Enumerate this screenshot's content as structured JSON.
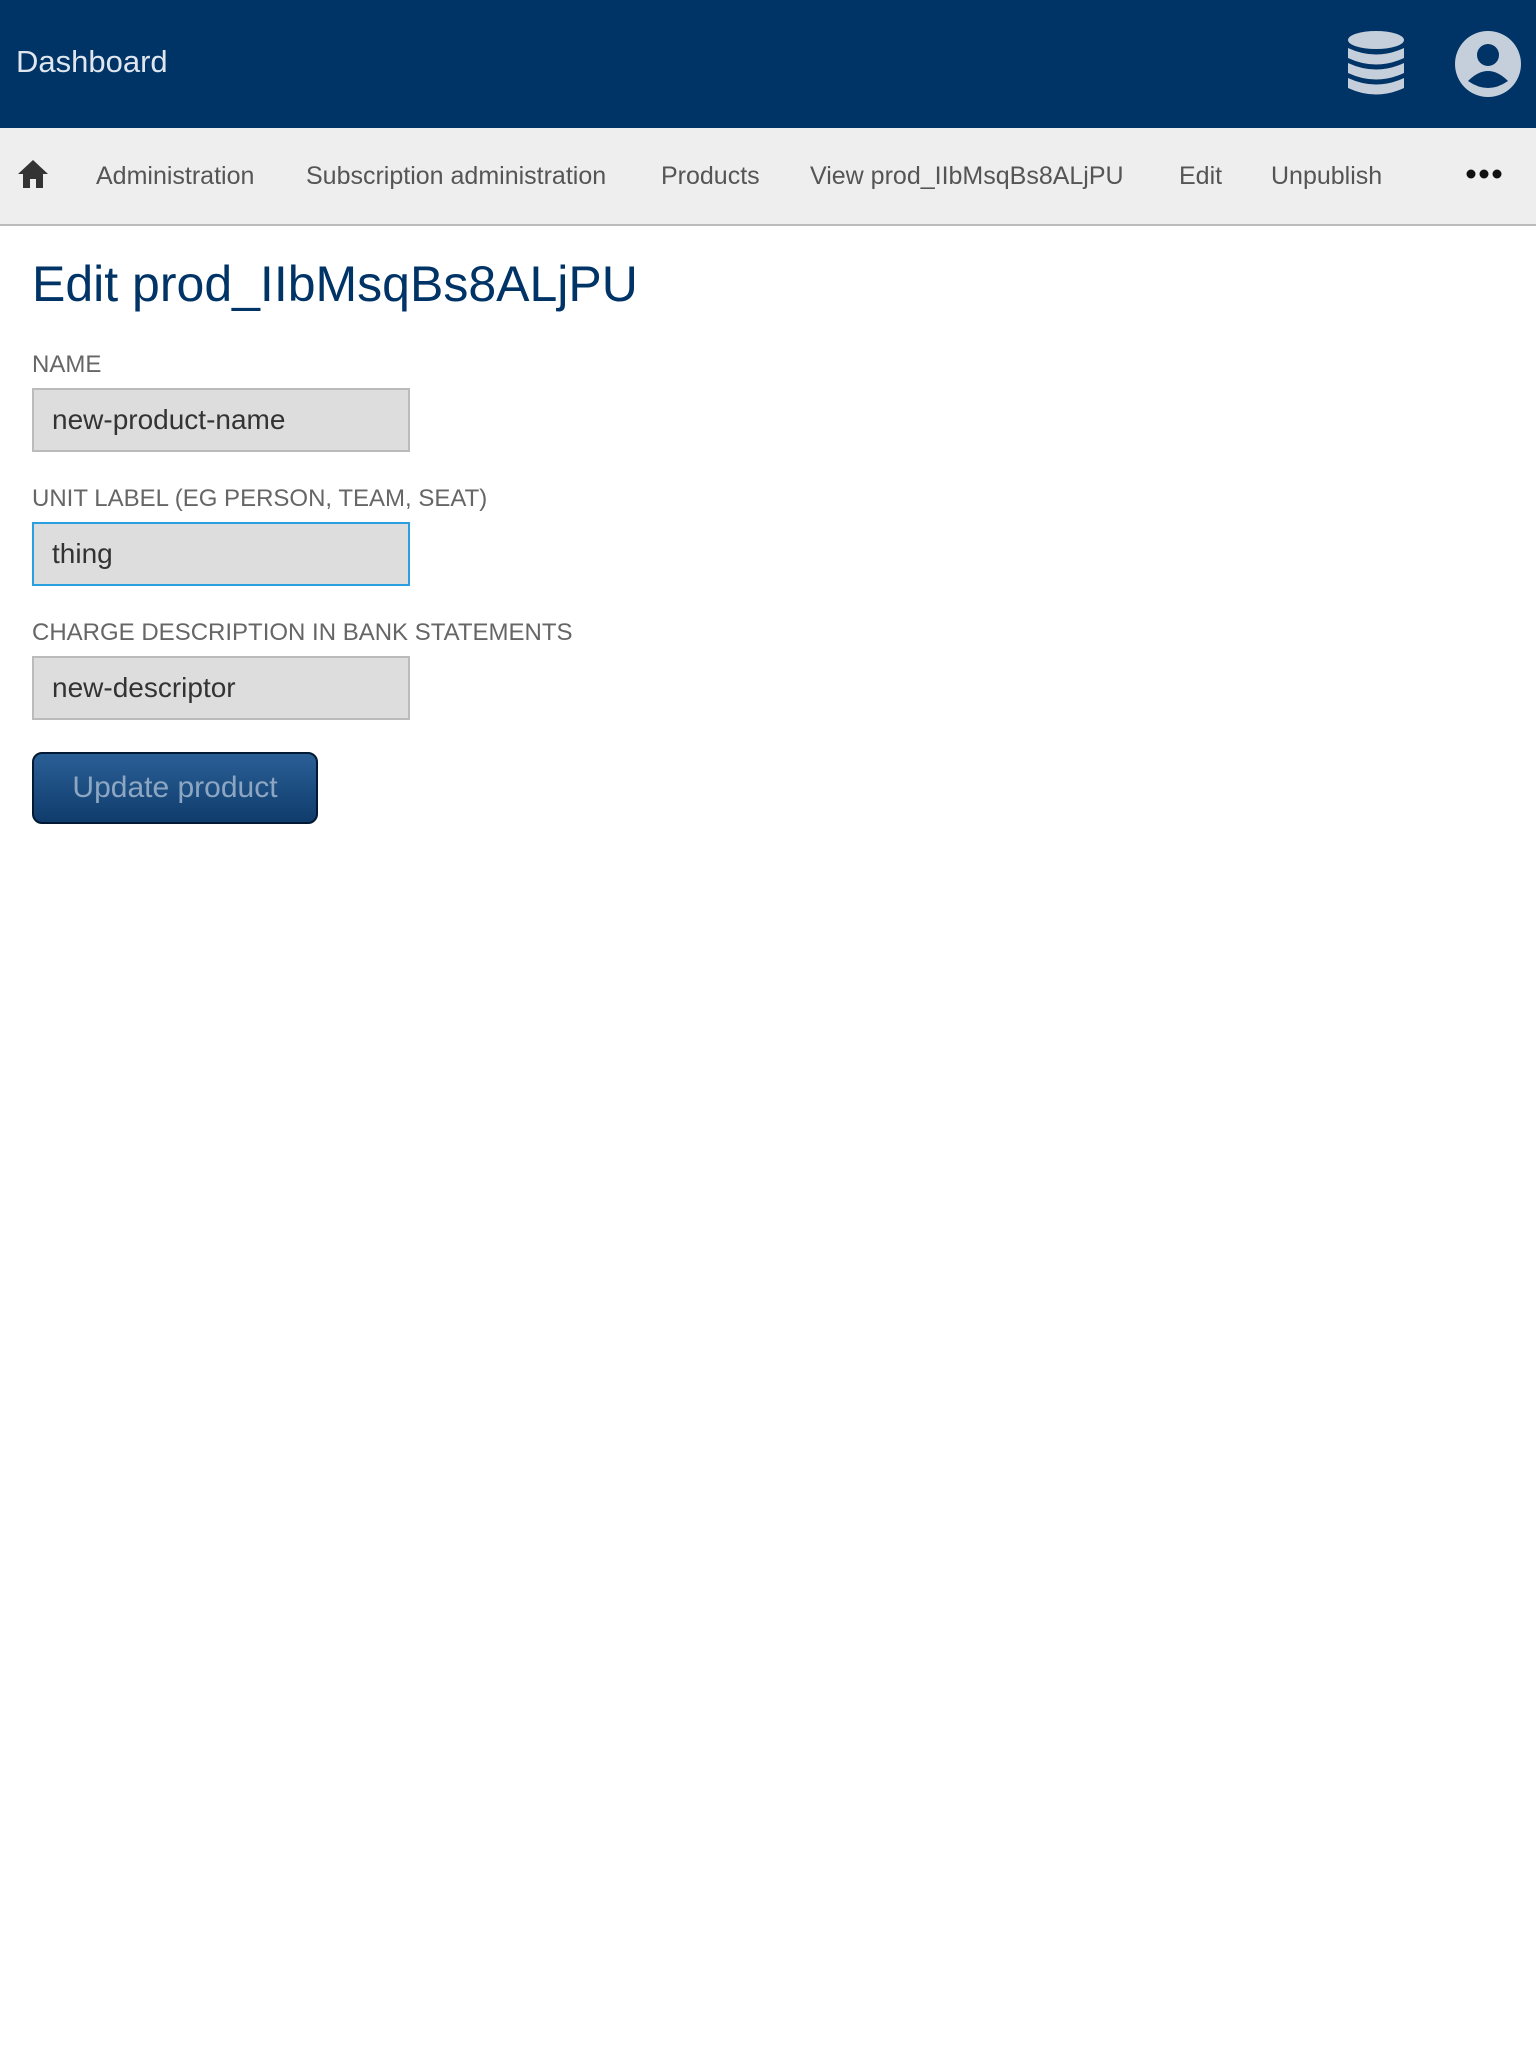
{
  "header": {
    "brand": "Dashboard",
    "icons": [
      "database-icon",
      "user-account-icon"
    ],
    "background": "#003366"
  },
  "nav": {
    "home_icon": "home-icon",
    "links": [
      {
        "label": "Administration"
      },
      {
        "label": "Subscription administration"
      },
      {
        "label": "Products"
      },
      {
        "label": "View prod_IIbMsqBs8ALjPU"
      },
      {
        "label": "Edit"
      },
      {
        "label": "Unpublish"
      }
    ],
    "more_icon": "more-dots-icon"
  },
  "main": {
    "title": "Edit prod_IIbMsqBs8ALjPU",
    "fields": {
      "name": {
        "label": "NAME",
        "value": "new-product-name"
      },
      "unit_label": {
        "label": "UNIT LABEL (EG PERSON, TEAM, SEAT)",
        "value": "thing",
        "focused": true
      },
      "descriptor": {
        "label": "CHARGE DESCRIPTION IN BANK STATEMENTS",
        "value": "new-descriptor"
      }
    },
    "submit_label": "Update product"
  },
  "colors": {
    "primary": "#003366",
    "focus": "#2b9fe0",
    "nav_bg": "#eeeeee"
  }
}
